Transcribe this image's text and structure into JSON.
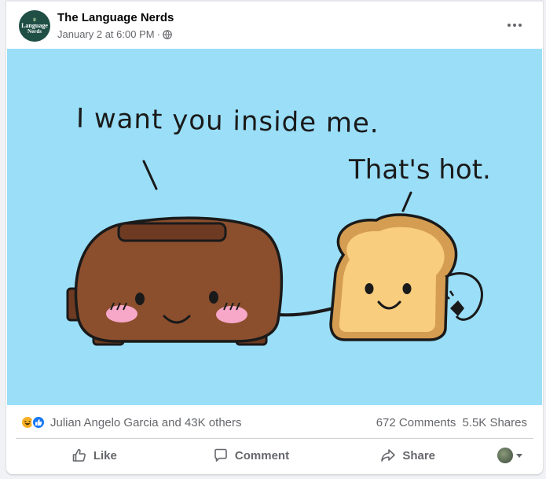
{
  "post": {
    "page_name": "The Language Nerds",
    "timestamp": "January 2 at 6:00 PM",
    "separator": "·",
    "audience_icon": "globe-icon",
    "avatar_text_line1": "Language",
    "avatar_text_line2": "Nerds",
    "more_icon": "more-options-icon"
  },
  "image": {
    "background_color": "#9adef8",
    "speech_left": "I want you inside me.",
    "speech_right": "That's hot."
  },
  "reactions": {
    "icons": [
      "haha-icon",
      "like-icon"
    ],
    "text": "Julian Angelo Garcia and 43K others",
    "comments": "672 Comments",
    "shares": "5.5K Shares"
  },
  "actions": {
    "like": "Like",
    "comment": "Comment",
    "share": "Share"
  },
  "colors": {
    "secondary_text": "#65676b",
    "like_blue": "#1877f2",
    "haha_yellow": "#f7b125"
  }
}
